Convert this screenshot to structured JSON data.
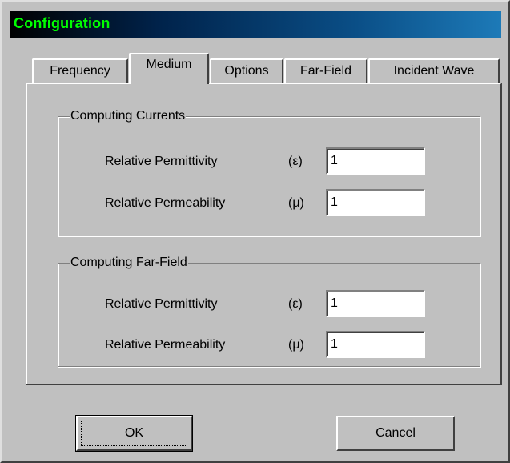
{
  "window": {
    "title": "Configuration"
  },
  "tabs": [
    {
      "label": "Frequency"
    },
    {
      "label": "Medium"
    },
    {
      "label": "Options"
    },
    {
      "label": "Far-Field"
    },
    {
      "label": "Incident Wave"
    }
  ],
  "active_tab": "Medium",
  "groups": {
    "currents": {
      "title": "Computing Currents",
      "permittivity": {
        "label": "Relative Permittivity",
        "symbol": "(ε)",
        "value": "1"
      },
      "permeability": {
        "label": "Relative Permeability",
        "symbol": "(μ)",
        "value": "1"
      }
    },
    "farfield": {
      "title": "Computing Far-Field",
      "permittivity": {
        "label": "Relative Permittivity",
        "symbol": "(ε)",
        "value": "1"
      },
      "permeability": {
        "label": "Relative Permeability",
        "symbol": "(μ)",
        "value": "1"
      }
    }
  },
  "buttons": {
    "ok": "OK",
    "cancel": "Cancel"
  },
  "colors": {
    "title_text": "#00ff00",
    "face": "#c0c0c0"
  }
}
